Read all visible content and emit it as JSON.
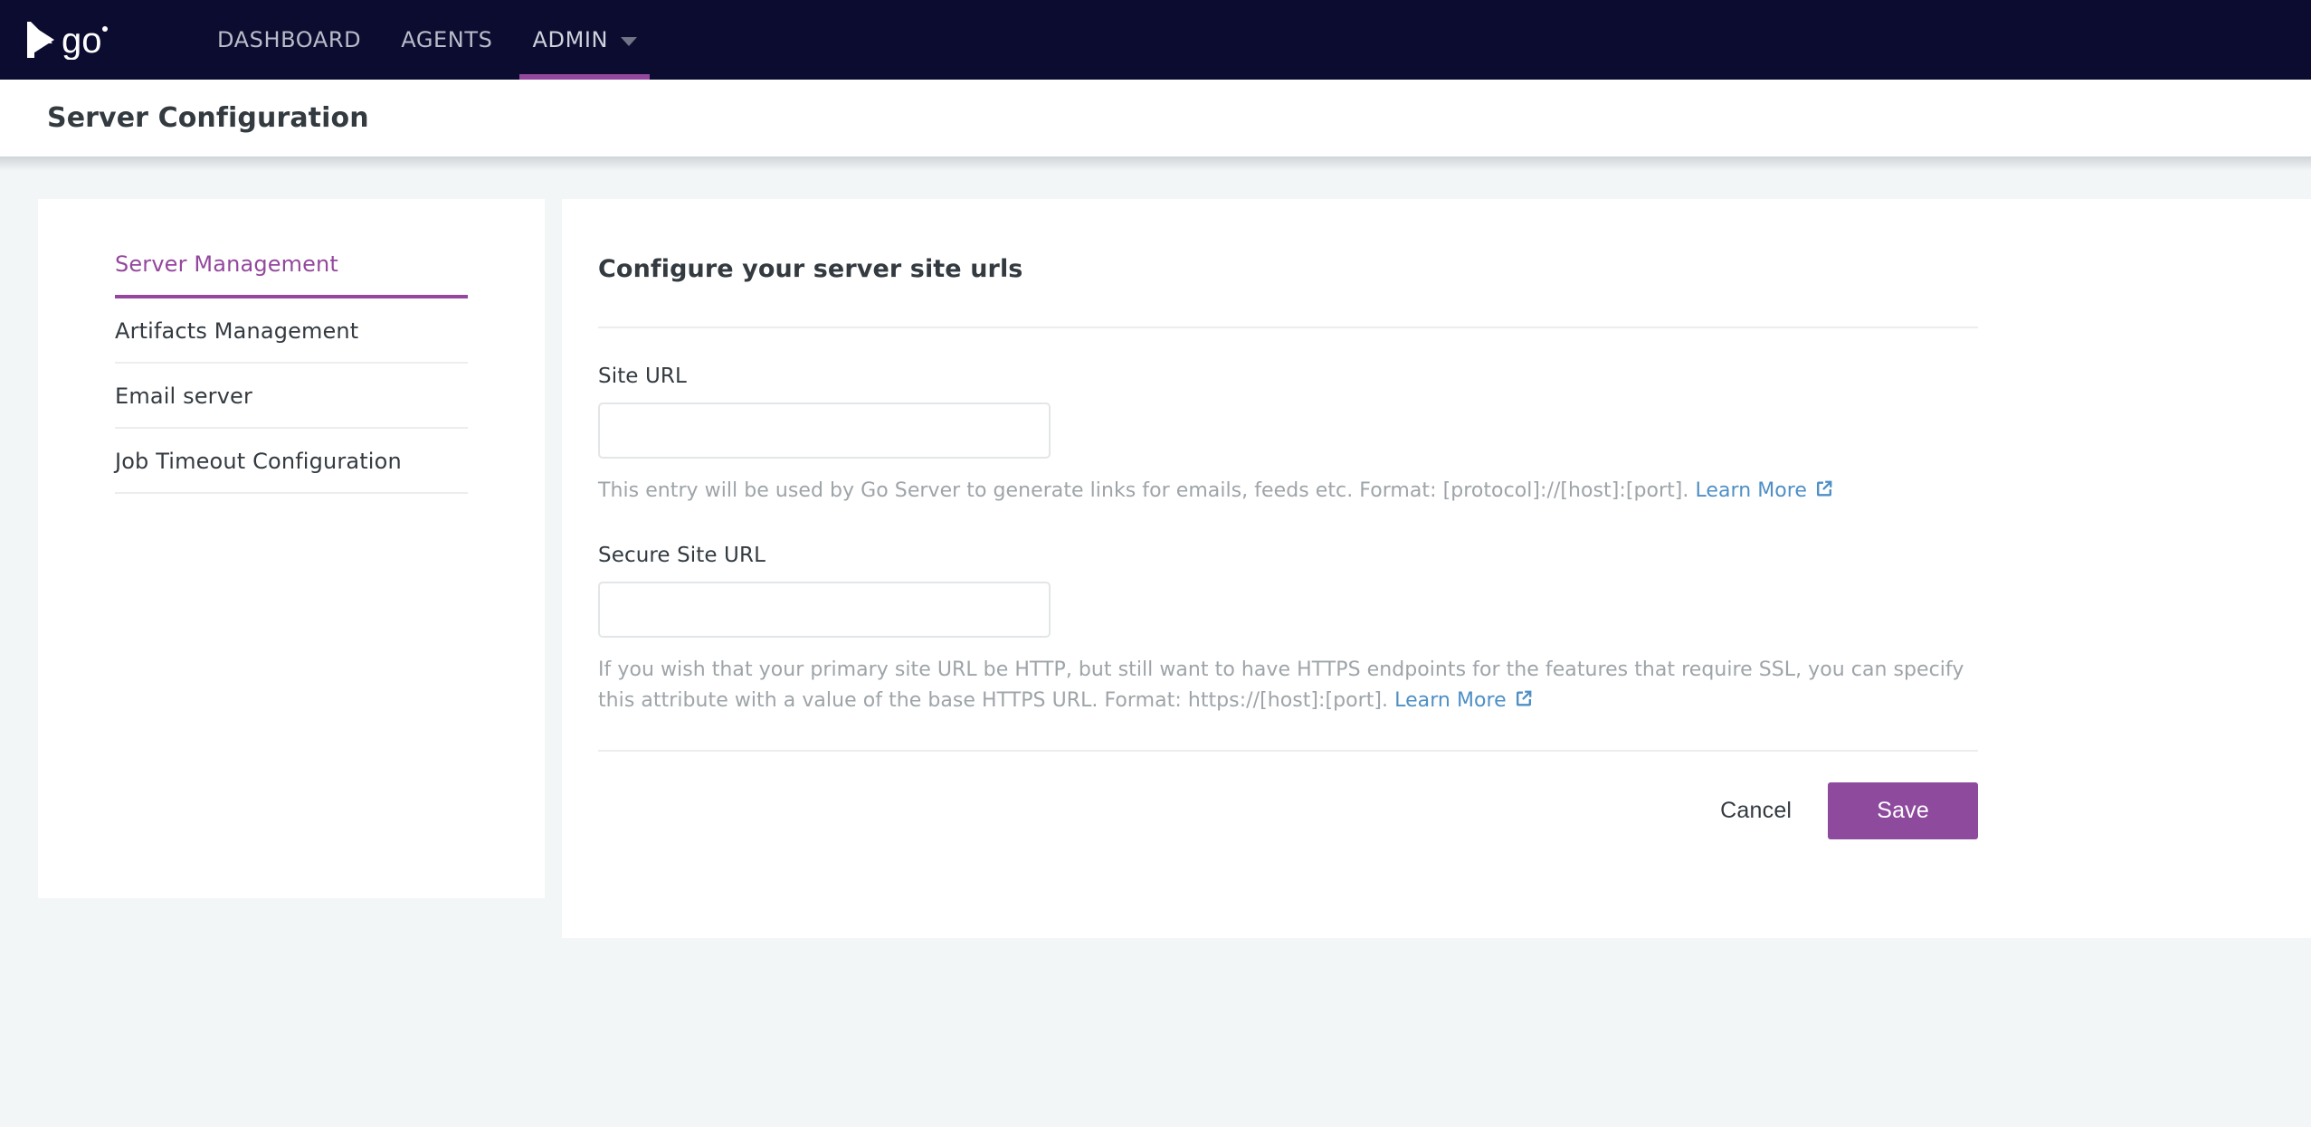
{
  "colors": {
    "nav_background": "#0c0c30",
    "accent_purple": "#94489d",
    "save_button": "#8e4a9d",
    "link_blue": "#4e8fc5",
    "page_background": "#f3f6f7",
    "helper_text": "#9ea4a8"
  },
  "topnav": {
    "logo_name": "gocd-logo",
    "logo_text": "go",
    "items": [
      {
        "label": "DASHBOARD",
        "active": false,
        "has_caret": false
      },
      {
        "label": "AGENTS",
        "active": false,
        "has_caret": false
      },
      {
        "label": "ADMIN",
        "active": true,
        "has_caret": true
      }
    ]
  },
  "header": {
    "title": "Server Configuration"
  },
  "sidebar": {
    "items": [
      {
        "label": "Server Management",
        "active": true
      },
      {
        "label": "Artifacts Management",
        "active": false
      },
      {
        "label": "Email server",
        "active": false
      },
      {
        "label": "Job Timeout Configuration",
        "active": false
      }
    ]
  },
  "main": {
    "section_title": "Configure your server site urls",
    "fields": [
      {
        "label": "Site URL",
        "value": "",
        "placeholder": "",
        "helper_text": "This entry will be used by Go Server to generate links for emails, feeds etc. Format: [protocol]://[host]:[port]. ",
        "learn_more_label": "Learn More",
        "learn_more_icon": "external-link-icon"
      },
      {
        "label": "Secure Site URL",
        "value": "",
        "placeholder": "",
        "helper_text": "If you wish that your primary site URL be HTTP, but still want to have HTTPS endpoints for the features that require SSL, you can specify this attribute with a value of the base HTTPS URL. Format: https://[host]:[port]. ",
        "learn_more_label": "Learn More",
        "learn_more_icon": "external-link-icon"
      }
    ],
    "buttons": {
      "cancel_label": "Cancel",
      "save_label": "Save"
    }
  }
}
